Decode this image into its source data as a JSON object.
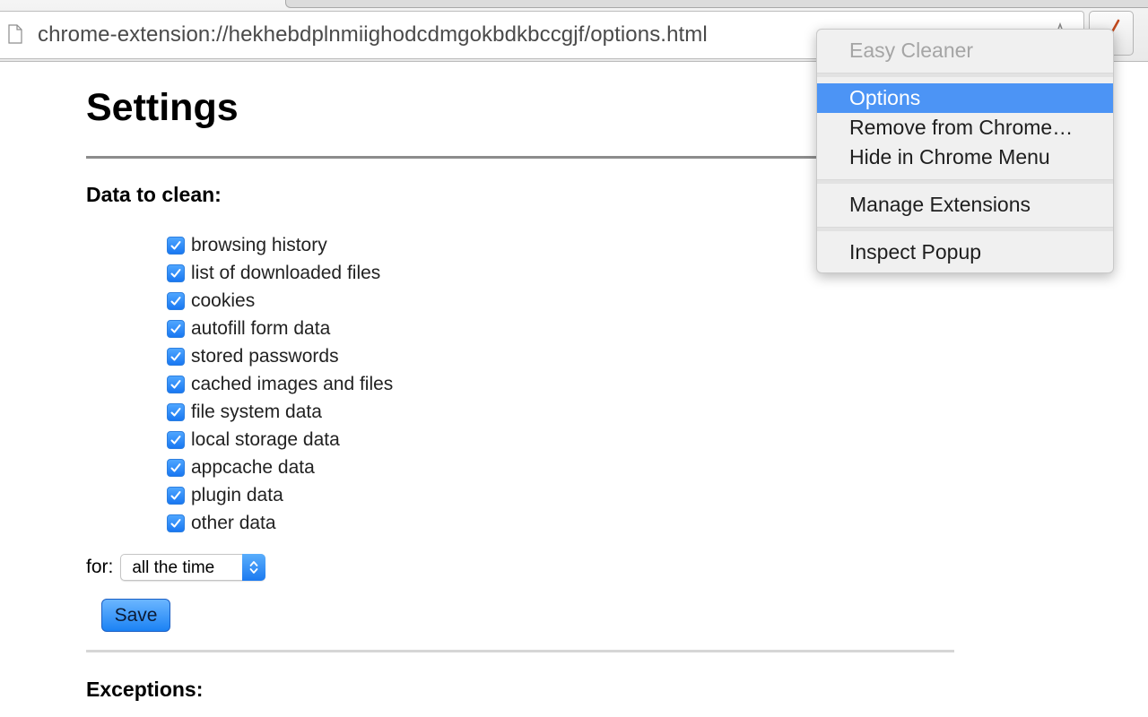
{
  "browser": {
    "url": "chrome-extension://hekhebdplnmiighodcdmgokbdkbccgjf/options.html",
    "icons": {
      "page": "page-icon",
      "bookmark": "star-icon",
      "extension": "broom-icon"
    }
  },
  "page": {
    "title": "Settings",
    "data_section_heading": "Data to clean:",
    "items": [
      {
        "label": "browsing history",
        "checked": true
      },
      {
        "label": "list of downloaded files",
        "checked": true
      },
      {
        "label": "cookies",
        "checked": true
      },
      {
        "label": "autofill form data",
        "checked": true
      },
      {
        "label": "stored passwords",
        "checked": true
      },
      {
        "label": "cached images and files",
        "checked": true
      },
      {
        "label": "file system data",
        "checked": true
      },
      {
        "label": "local storage data",
        "checked": true
      },
      {
        "label": "appcache data",
        "checked": true
      },
      {
        "label": "plugin data",
        "checked": true
      },
      {
        "label": "other data",
        "checked": true
      }
    ],
    "for_label": "for:",
    "period_select": {
      "value": "all the time"
    },
    "save_label": "Save",
    "exceptions_heading": "Exceptions:"
  },
  "menu": {
    "header": "Easy Cleaner",
    "items": [
      "Options",
      "Remove from Chrome…",
      "Hide in Chrome Menu",
      "Manage Extensions",
      "Inspect Popup"
    ],
    "selected": "Options"
  },
  "colors": {
    "accent": "#1b82f4",
    "menu_highlight": "#4c94f5",
    "checkbox": "#2d7fe0"
  }
}
